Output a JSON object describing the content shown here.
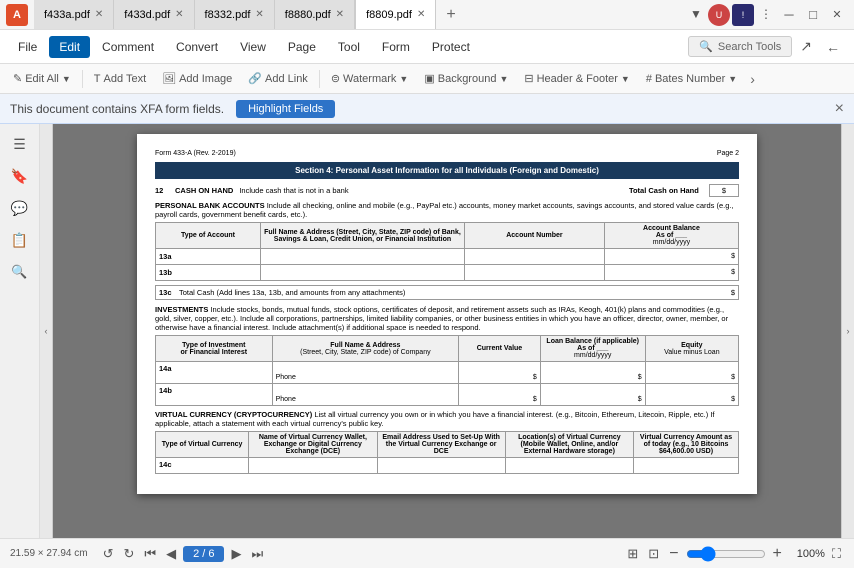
{
  "app": {
    "icon": "A",
    "icon_color": "#e04e2a"
  },
  "tabs": [
    {
      "id": "f433a",
      "label": "f433a.pdf",
      "active": false
    },
    {
      "id": "f433d",
      "label": "f433d.pdf",
      "active": false
    },
    {
      "id": "f8332",
      "label": "f8332.pdf",
      "active": false
    },
    {
      "id": "f8880",
      "label": "f8880.pdf",
      "active": false
    },
    {
      "id": "f8809",
      "label": "f8809.pdf",
      "active": true
    }
  ],
  "menu": {
    "items": [
      {
        "id": "file",
        "label": "File"
      },
      {
        "id": "edit",
        "label": "Edit",
        "active": true
      },
      {
        "id": "comment",
        "label": "Comment"
      },
      {
        "id": "convert",
        "label": "Convert"
      },
      {
        "id": "view",
        "label": "View"
      },
      {
        "id": "page",
        "label": "Page"
      },
      {
        "id": "tool",
        "label": "Tool"
      },
      {
        "id": "form",
        "label": "Form"
      },
      {
        "id": "protect",
        "label": "Protect"
      }
    ],
    "search_placeholder": "Search Tools"
  },
  "toolbar": {
    "items": [
      {
        "id": "edit-all",
        "label": "Edit All",
        "icon": "✎"
      },
      {
        "id": "add-text",
        "label": "Add Text",
        "icon": "T"
      },
      {
        "id": "add-image",
        "label": "Add Image",
        "icon": "⊞"
      },
      {
        "id": "add-link",
        "label": "Add Link",
        "icon": "🔗"
      },
      {
        "id": "watermark",
        "label": "Watermark",
        "icon": "⊜"
      },
      {
        "id": "background",
        "label": "Background",
        "icon": "▣"
      },
      {
        "id": "header-footer",
        "label": "Header & Footer",
        "icon": "⊟"
      },
      {
        "id": "bates-number",
        "label": "Bates Number",
        "icon": "#"
      }
    ]
  },
  "notification": {
    "message": "This document contains XFA form fields.",
    "button_label": "Highlight Fields",
    "close_label": "×"
  },
  "sidebar_icons": [
    "☰",
    "🔖",
    "💬",
    "📋",
    "🔍"
  ],
  "pdf": {
    "page_header_left": "Form 433-A (Rev. 2-2019)",
    "page_header_right": "Page 2",
    "section_title": "Section 4: Personal Asset Information for all Individuals (Foreign and Domestic)",
    "row12_label": "12",
    "row12_title": "CASH ON HAND",
    "row12_desc": "Include cash that is not in a bank",
    "row12_total_label": "Total Cash on Hand",
    "row12_dollar": "$",
    "personal_bank_title": "PERSONAL BANK ACCOUNTS",
    "personal_bank_desc": "Include all checking, online and mobile (e.g., PayPal etc.) accounts, money market accounts, savings accounts, and stored value cards (e.g., payroll cards, government benefit cards, etc.).",
    "bank_table_headers": [
      "Type of Account",
      "Full Name & Address (Street, City, State, ZIP code) of Bank, Savings & Loan, Credit Union, or Financial Institution",
      "Account Number",
      "Account Balance\nAs of ___\nmm/dd/yyyy"
    ],
    "rows_13": [
      {
        "id": "13a",
        "label": "13a"
      },
      {
        "id": "13b",
        "label": "13b"
      }
    ],
    "row13c_label": "13c",
    "row13c_desc": "Total Cash (Add lines 13a, 13b, and amounts from any attachments)",
    "row13c_dollar": "$",
    "investments_title": "INVESTMENTS",
    "investments_desc": "Include stocks, bonds, mutual funds, stock options, certificates of deposit, and retirement assets such as IRAs, Keogh, 401(k) plans and commodities (e.g., gold, silver, copper, etc.). Include all corporations, partnerships, limited liability companies, or other business entities in which you have an officer, director, owner, member, or otherwise have a financial interest. Include attachment(s) if additional space is needed to respond.",
    "investment_table_headers": [
      "Type of Investment\nor Financial Interest",
      "Full Name & Address\n(Street, City, State, ZIP code) of Company",
      "Current Value",
      "Loan Balance (if applicable)\nAs of ___\nmm/dd/yyyy",
      "Equity\nValue minus Loan"
    ],
    "rows_14": [
      {
        "id": "14a",
        "label": "14a",
        "phone": "Phone"
      },
      {
        "id": "14b",
        "label": "14b",
        "phone": "Phone"
      }
    ],
    "virtual_currency_title": "VIRTUAL CURRENCY (CRYPTOCURRENCY)",
    "virtual_currency_desc": "List all virtual currency you own or in which you have a financial interest. (e.g., Bitcoin, Ethereum, Litecoin, Ripple, etc.) If applicable, attach a statement with each virtual currency's public key.",
    "vc_table_headers": [
      "Type of Virtual Currency",
      "Name of Virtual Currency Wallet, Exchange or Digital Currency Exchange (DCE)",
      "Email Address Used to Set-Up With the Virtual Currency Exchange or DCE",
      "Location(s) of Virtual Currency (Mobile Wallet, Online, and/or External Hardware storage)",
      "Virtual Currency Amount as of today (e.g., 10 Bitcoins $64,600.00 USD)"
    ],
    "row14c_label": "14c"
  },
  "bottom_bar": {
    "doc_size": "21.59 × 27.94 cm",
    "page_indicator": "2 / 6",
    "zoom_level": "100%",
    "nav_buttons": [
      "⟳",
      "↷",
      "◀",
      "◁",
      "▷",
      "▶"
    ],
    "fit_icons": [
      "⊞",
      "⊡"
    ]
  },
  "window_controls": {
    "minimize": "─",
    "maximize": "□",
    "close": "✕"
  }
}
